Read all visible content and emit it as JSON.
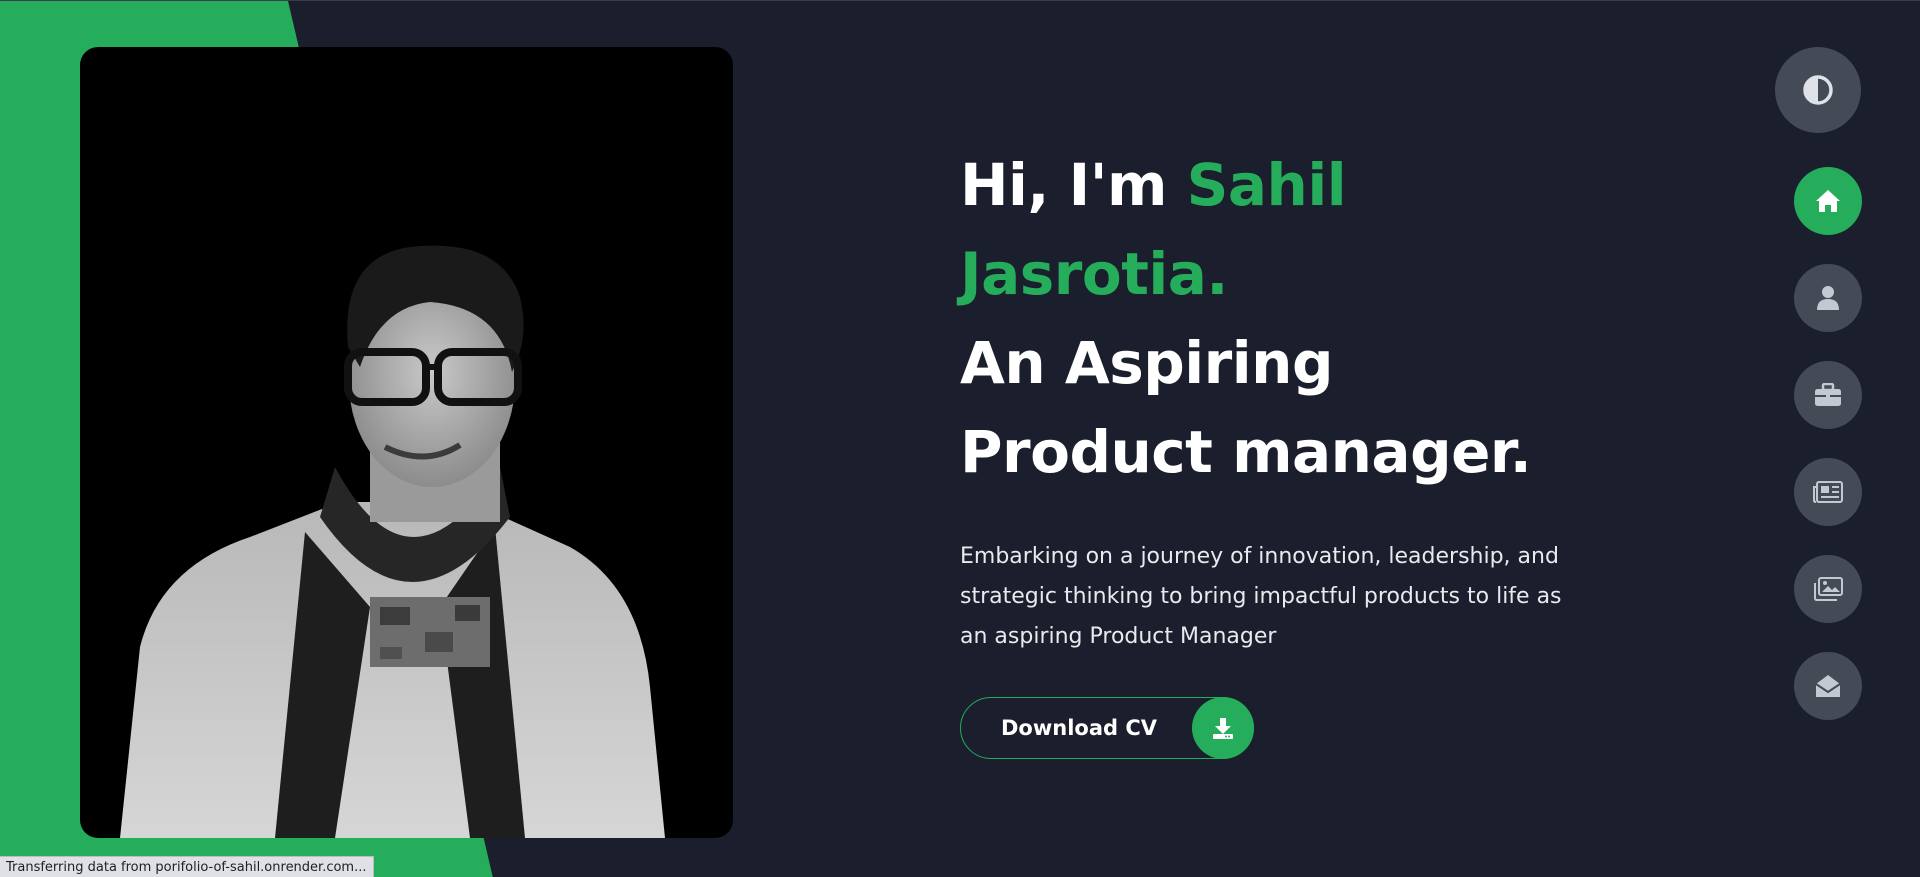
{
  "hero": {
    "greeting": "Hi, I'm ",
    "first_name": "Sahil",
    "last_name": "Jasrotia.",
    "role_line1": "An Aspiring",
    "role_line2": "Product manager.",
    "description": "Embarking on a journey of innovation, leadership, and strategic thinking to bring impactful products to life as an aspiring Product Manager",
    "cv_button_label": "Download CV",
    "cv_icon": "download-icon"
  },
  "theme_toggle": {
    "icon": "contrast-icon"
  },
  "nav": {
    "items": [
      {
        "icon": "home-icon",
        "active": true
      },
      {
        "icon": "user-icon",
        "active": false
      },
      {
        "icon": "briefcase-icon",
        "active": false
      },
      {
        "icon": "newspaper-icon",
        "active": false
      },
      {
        "icon": "images-icon",
        "active": false
      },
      {
        "icon": "envelope-open-icon",
        "active": false
      }
    ]
  },
  "status_bar": {
    "text": "Transferring data from porifolio-of-sahil.onrender.com..."
  },
  "colors": {
    "accent": "#25ad5c",
    "background": "#1b1e2c",
    "nav_button": "#454b56"
  }
}
